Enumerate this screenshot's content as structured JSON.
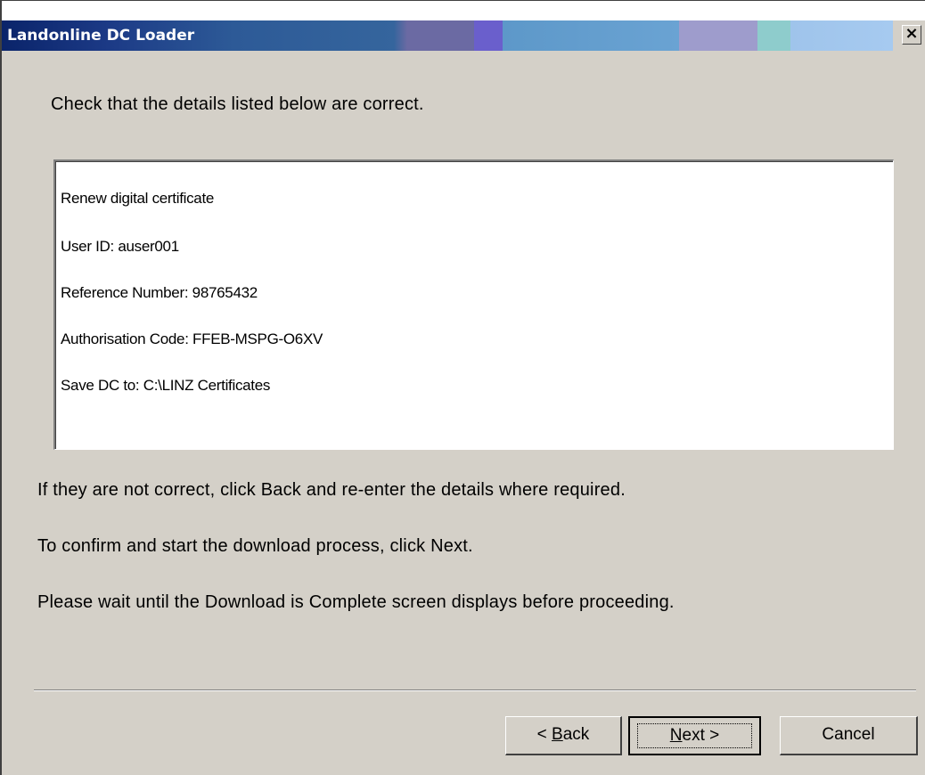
{
  "window": {
    "title": "Landonline DC Loader",
    "close_glyph": "×"
  },
  "intro": "Check that the details listed below are correct.",
  "details": {
    "action": "Renew digital certificate",
    "user_id": "User ID:  auser001",
    "reference_number": "Reference Number: 98765432",
    "authorisation_code": "Authorisation Code: FFEB-MSPG-O6XV",
    "save_location": "Save DC to: C:\\LINZ Certificates"
  },
  "instructions": {
    "back": "If they are not correct, click Back and re-enter the details where required.",
    "next": "To confirm and start the download process, click Next.",
    "wait": "Please wait until the Download is Complete screen displays before proceeding."
  },
  "buttons": {
    "back_prefix": "< ",
    "back_mnemonic": "B",
    "back_rest": "ack",
    "next_mnemonic": "N",
    "next_rest": "ext >",
    "cancel": "Cancel"
  },
  "icons": {
    "close": "close-icon"
  }
}
